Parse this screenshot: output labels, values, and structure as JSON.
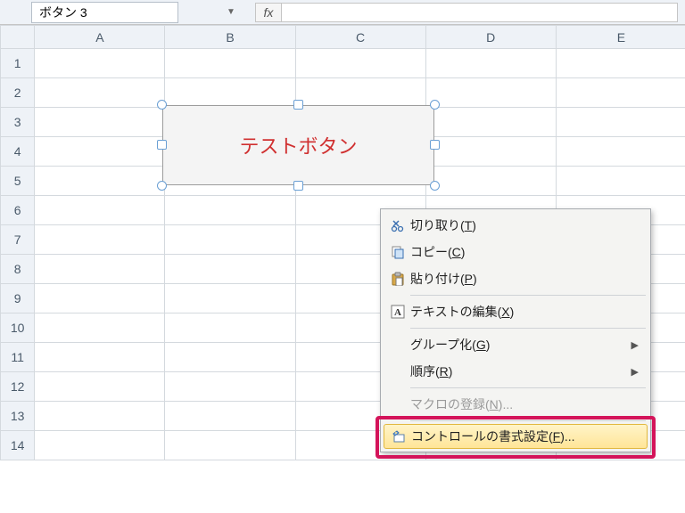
{
  "formula_bar": {
    "name_box": "ボタン 3",
    "fx_label": "fx",
    "formula_value": ""
  },
  "columns": [
    "A",
    "B",
    "C",
    "D",
    "E"
  ],
  "rows": [
    "1",
    "2",
    "3",
    "4",
    "5",
    "6",
    "7",
    "8",
    "9",
    "10",
    "11",
    "12",
    "13",
    "14"
  ],
  "shape": {
    "label": "テストボタン"
  },
  "context_menu": {
    "items": [
      {
        "key": "cut",
        "label": "切り取り",
        "accel": "T",
        "icon": "cut-icon",
        "has_arrow": false,
        "sep_after": false,
        "disabled": false
      },
      {
        "key": "copy",
        "label": "コピー",
        "accel": "C",
        "icon": "copy-icon",
        "has_arrow": false,
        "sep_after": false,
        "disabled": false
      },
      {
        "key": "paste",
        "label": "貼り付け",
        "accel": "P",
        "icon": "paste-icon",
        "has_arrow": false,
        "sep_after": true,
        "disabled": false
      },
      {
        "key": "edit",
        "label": "テキストの編集",
        "accel": "X",
        "icon": "textedit-icon",
        "has_arrow": false,
        "sep_after": true,
        "disabled": false
      },
      {
        "key": "group",
        "label": "グループ化",
        "accel": "G",
        "icon": "",
        "has_arrow": true,
        "sep_after": false,
        "disabled": false
      },
      {
        "key": "order",
        "label": "順序",
        "accel": "R",
        "icon": "",
        "has_arrow": true,
        "sep_after": true,
        "disabled": false
      },
      {
        "key": "macro",
        "label": "マクロの登録",
        "accel": "N",
        "suffix": "...",
        "icon": "",
        "has_arrow": false,
        "sep_after": true,
        "disabled": true
      },
      {
        "key": "format",
        "label": "コントロールの書式設定",
        "accel": "F",
        "suffix": "...",
        "icon": "format-icon",
        "has_arrow": false,
        "sep_after": false,
        "disabled": false,
        "hover": true
      }
    ]
  }
}
